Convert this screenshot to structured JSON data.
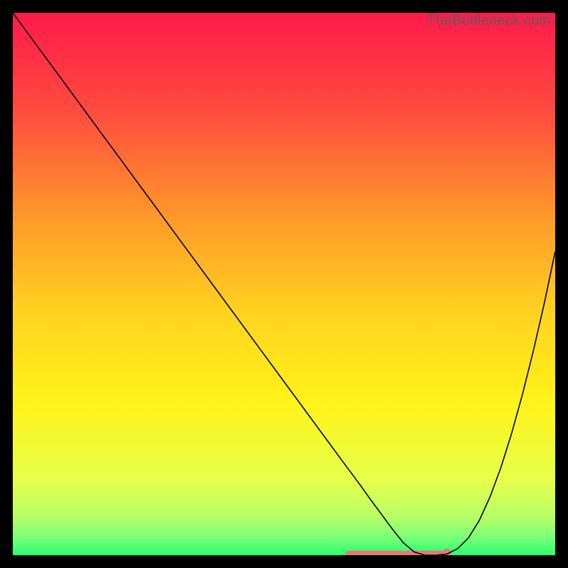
{
  "watermark": "TheBottleneck.com",
  "chart_data": {
    "type": "line",
    "title": "",
    "xlabel": "",
    "ylabel": "",
    "xlim": [
      0,
      100
    ],
    "ylim": [
      0,
      100
    ],
    "background_gradient": {
      "stops": [
        {
          "pos": 0.0,
          "color": "#ff1a4b"
        },
        {
          "pos": 0.18,
          "color": "#ff4b3f"
        },
        {
          "pos": 0.38,
          "color": "#ff9a2a"
        },
        {
          "pos": 0.55,
          "color": "#ffd21f"
        },
        {
          "pos": 0.72,
          "color": "#fff319"
        },
        {
          "pos": 0.86,
          "color": "#e6ff4a"
        },
        {
          "pos": 0.93,
          "color": "#b6ff66"
        },
        {
          "pos": 0.965,
          "color": "#7eff78"
        },
        {
          "pos": 1.0,
          "color": "#2aff6f"
        }
      ]
    },
    "series": [
      {
        "name": "bottleneck-curve",
        "stroke": "#000000",
        "stroke_width": 1.6,
        "x": [
          0,
          5,
          10,
          15,
          20,
          25,
          30,
          35,
          40,
          45,
          50,
          55,
          60,
          62,
          64,
          66,
          68,
          70,
          72,
          74,
          76,
          78,
          80,
          82,
          84,
          86,
          88,
          90,
          92,
          94,
          96,
          98,
          100
        ],
        "y": [
          100,
          93.2,
          86.4,
          79.6,
          72.8,
          66.0,
          59.2,
          52.4,
          45.6,
          38.8,
          32.0,
          25.2,
          18.4,
          15.7,
          13.0,
          10.2,
          7.5,
          4.8,
          2.3,
          0.6,
          0.0,
          0.0,
          0.2,
          1.2,
          3.2,
          6.4,
          10.8,
          16.2,
          22.6,
          29.8,
          37.8,
          46.5,
          56.0
        ]
      }
    ],
    "flat_band": {
      "color": "#e27a76",
      "x_start": 62,
      "x_end": 80,
      "y": 0.2,
      "thickness": 10,
      "end_dot_radius": 6
    }
  }
}
